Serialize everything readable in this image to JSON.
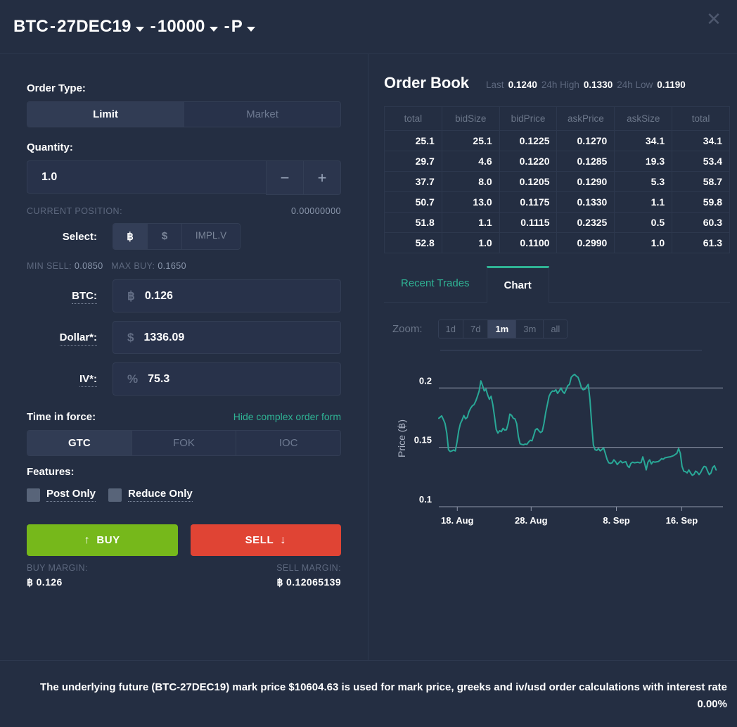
{
  "header": {
    "instrument": "BTC",
    "expiry": "27DEC19",
    "strike": "10000",
    "option_type": "P",
    "sep": "-",
    "close_icon": "close-icon"
  },
  "order_form": {
    "order_type_label": "Order Type:",
    "order_types": [
      "Limit",
      "Market"
    ],
    "order_type_active": "Limit",
    "quantity_label": "Quantity:",
    "quantity_value": "1.0",
    "minus_label": "−",
    "plus_label": "+",
    "current_position_label": "CURRENT POSITION:",
    "current_position_value": "0.00000000",
    "select_label": "Select:",
    "select_options": [
      "฿",
      "$",
      "IMPL.V"
    ],
    "select_active": "฿",
    "min_sell_label": "MIN SELL:",
    "min_sell_value": "0.0850",
    "max_buy_label": "MAX BUY:",
    "max_buy_value": "0.1650",
    "btc_label": "BTC:",
    "btc_prefix": "฿",
    "btc_value": "0.126",
    "dollar_label": "Dollar*:",
    "dollar_prefix": "$",
    "dollar_value": "1336.09",
    "iv_label": "IV*:",
    "iv_prefix": "%",
    "iv_value": "75.3",
    "tif_label": "Time in force:",
    "hide_form_link": "Hide complex order form",
    "tif_options": [
      "GTC",
      "FOK",
      "IOC"
    ],
    "tif_active": "GTC",
    "features_label": "Features:",
    "post_only_label": "Post Only",
    "reduce_only_label": "Reduce Only",
    "buy_label": "BUY",
    "sell_label": "SELL",
    "buy_arrow": "↑",
    "sell_arrow": "↓",
    "buy_margin_label": "BUY MARGIN:",
    "buy_margin_value": "฿ 0.126",
    "sell_margin_label": "SELL MARGIN:",
    "sell_margin_value": "฿ 0.12065139"
  },
  "order_book": {
    "title": "Order Book",
    "last_label": "Last",
    "last_value": "0.1240",
    "high_label": "24h High",
    "high_value": "0.1330",
    "low_label": "24h Low",
    "low_value": "0.1190",
    "columns": [
      "total",
      "bidSize",
      "bidPrice",
      "askPrice",
      "askSize",
      "total"
    ],
    "rows": [
      [
        "25.1",
        "25.1",
        "0.1225",
        "0.1270",
        "34.1",
        "34.1"
      ],
      [
        "29.7",
        "4.6",
        "0.1220",
        "0.1285",
        "19.3",
        "53.4"
      ],
      [
        "37.7",
        "8.0",
        "0.1205",
        "0.1290",
        "5.3",
        "58.7"
      ],
      [
        "50.7",
        "13.0",
        "0.1175",
        "0.1330",
        "1.1",
        "59.8"
      ],
      [
        "51.8",
        "1.1",
        "0.1115",
        "0.2325",
        "0.5",
        "60.3"
      ],
      [
        "52.8",
        "1.0",
        "0.1100",
        "0.2990",
        "1.0",
        "61.3"
      ]
    ]
  },
  "panel_tabs": {
    "tabs": [
      "Recent Trades",
      "Chart"
    ],
    "active": "Chart"
  },
  "chart_controls": {
    "zoom_label": "Zoom:",
    "ranges": [
      "1d",
      "7d",
      "1m",
      "3m",
      "all"
    ],
    "active_range": "1m"
  },
  "chart_data": {
    "type": "line",
    "title": "",
    "xlabel": "",
    "ylabel": "Price (฿)",
    "ylim": [
      0.1,
      0.215
    ],
    "xlim": [
      0,
      100
    ],
    "grid": true,
    "line_color": "#29a897",
    "yticks": [
      0.1,
      0.15,
      0.2
    ],
    "ytick_labels": [
      "0.1",
      "0.15",
      "0.2"
    ],
    "xticks": [
      6.5,
      32.5,
      62.5,
      85.5
    ],
    "xtick_labels": [
      "18. Aug",
      "28. Aug",
      "8. Sep",
      "16. Sep"
    ],
    "series": [
      {
        "name": "Price",
        "x": [
          0,
          1,
          1.6,
          2.2,
          2.8,
          3.4,
          4,
          4.6,
          5.2,
          5.8,
          6.4,
          7,
          7.6,
          8.2,
          8.8,
          9.4,
          10,
          10.6,
          11.2,
          11.8,
          12.4,
          13,
          13.6,
          14.2,
          14.8,
          15.4,
          16,
          16.6,
          17.2,
          17.8,
          18.4,
          19,
          19.6,
          20.2,
          20.8,
          21.4,
          22,
          22.6,
          23.2,
          23.8,
          24.4,
          25,
          25.6,
          26.2,
          26.8,
          27.4,
          28,
          28.6,
          29.2,
          29.8,
          30.4,
          31,
          31.6,
          32.2,
          32.8,
          33.4,
          34,
          34.6,
          35.2,
          35.8,
          36.4,
          37,
          37.6,
          38.2,
          38.8,
          39.4,
          40,
          40.6,
          41.2,
          41.8,
          42.4,
          43,
          43.6,
          44.2,
          44.8,
          45.4,
          46,
          46.6,
          47.2,
          47.8,
          48.4,
          49,
          49.6,
          50.2,
          50.8,
          51.4,
          52,
          52.6,
          53.2,
          53.8,
          54.4,
          55,
          55.6,
          56.2,
          56.8,
          57.4,
          58,
          58.6,
          59.2,
          59.8,
          60.4,
          61,
          61.6,
          62.2,
          62.8,
          63.4,
          64,
          64.6,
          65.2,
          65.8,
          66.4,
          67,
          67.6,
          68.2,
          68.8,
          69.4,
          70,
          70.6,
          71.2,
          71.8,
          72.4,
          73,
          73.6,
          74.2,
          74.8,
          75.4,
          76,
          76.6,
          77.2,
          77.8,
          78.4,
          79,
          79.6,
          80.2,
          80.8,
          81.4,
          82,
          82.6,
          83.2,
          83.8,
          84.4,
          85,
          85.6,
          86.2,
          86.8,
          87.4,
          88,
          88.6,
          89.2,
          89.8,
          90.4,
          91,
          91.6,
          92.2,
          92.8,
          93.4,
          94,
          94.6,
          95.2,
          95.8,
          96.4,
          97,
          97.6,
          98.2,
          98.8,
          99.4,
          100
        ],
        "y": [
          0.1745,
          0.1765,
          0.1735,
          0.17,
          0.162,
          0.148,
          0.1465,
          0.147,
          0.1478,
          0.147,
          0.1545,
          0.164,
          0.17,
          0.173,
          0.1768,
          0.174,
          0.1752,
          0.18,
          0.183,
          0.185,
          0.186,
          0.189,
          0.193,
          0.1975,
          0.206,
          0.202,
          0.1975,
          0.199,
          0.194,
          0.1905,
          0.193,
          0.186,
          0.176,
          0.165,
          0.162,
          0.164,
          0.1632,
          0.166,
          0.1645,
          0.1648,
          0.17,
          0.178,
          0.177,
          0.1745,
          0.174,
          0.17,
          0.159,
          0.153,
          0.1525,
          0.1522,
          0.1528,
          0.1525,
          0.1545,
          0.156,
          0.1555,
          0.16,
          0.1648,
          0.1658,
          0.164,
          0.1625,
          0.1635,
          0.17,
          0.179,
          0.186,
          0.193,
          0.196,
          0.1975,
          0.1972,
          0.1985,
          0.1955,
          0.1975,
          0.2,
          0.197,
          0.1955,
          0.1985,
          0.202,
          0.203,
          0.209,
          0.2105,
          0.2115,
          0.21,
          0.209,
          0.205,
          0.2,
          0.1985,
          0.199,
          0.201,
          0.203,
          0.19,
          0.17,
          0.152,
          0.148,
          0.1475,
          0.149,
          0.147,
          0.1482,
          0.1495,
          0.145,
          0.14,
          0.137,
          0.1365,
          0.137,
          0.1395,
          0.138,
          0.1355,
          0.1372,
          0.1385,
          0.137,
          0.1375,
          0.138,
          0.1345,
          0.133,
          0.1365,
          0.1375,
          0.137,
          0.1372,
          0.1375,
          0.137,
          0.1372,
          0.142,
          0.137,
          0.131,
          0.1375,
          0.1395,
          0.136,
          0.138,
          0.1375,
          0.1378,
          0.138,
          0.139,
          0.1405,
          0.14,
          0.1412,
          0.1415,
          0.1418,
          0.142,
          0.1425,
          0.143,
          0.144,
          0.145,
          0.149,
          0.145,
          0.134,
          0.13,
          0.1295,
          0.1285,
          0.131,
          0.1285,
          0.1265,
          0.1272,
          0.13,
          0.129,
          0.127,
          0.129,
          0.132,
          0.134,
          0.1335,
          0.13,
          0.127,
          0.1285,
          0.133,
          0.1345,
          0.131
        ]
      }
    ]
  },
  "footer": {
    "text": "The underlying future (BTC-27DEC19) mark price $10604.63 is used for mark price, greeks and iv/usd order calculations with interest rate 0.00%"
  }
}
